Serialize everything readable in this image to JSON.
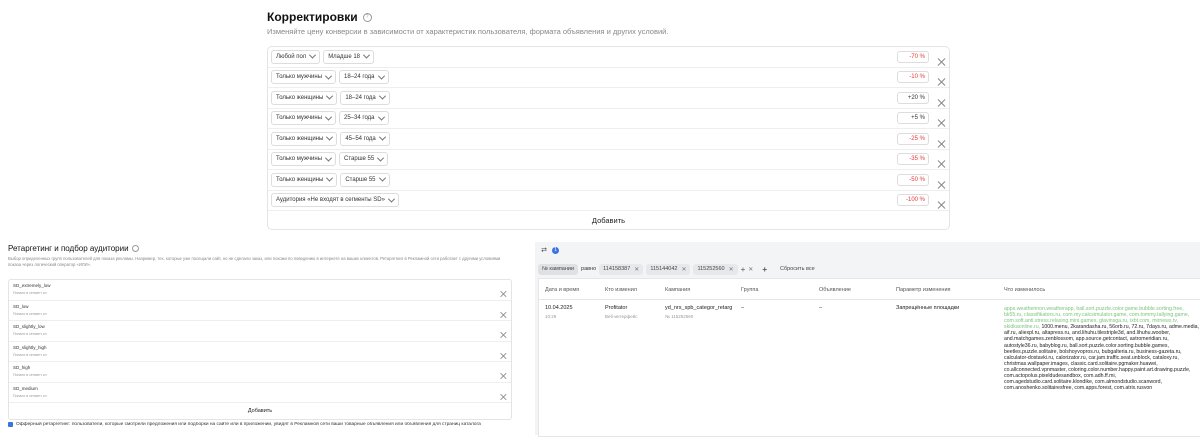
{
  "adjustments": {
    "title": "Корректировки",
    "subtitle": "Изменяйте цену конверсии в зависимости от характеристик пользователя, формата объявления и других условий.",
    "rows": [
      {
        "a": "Любой пол",
        "b": "Младше 18",
        "value": "-70 %",
        "negative": true
      },
      {
        "a": "Только мужчины",
        "b": "18–24 года",
        "value": "-10 %",
        "negative": true
      },
      {
        "a": "Только женщины",
        "b": "18–24 года",
        "value": "+20 %",
        "negative": false
      },
      {
        "a": "Только мужчины",
        "b": "25–34 года",
        "value": "+5 %",
        "negative": false
      },
      {
        "a": "Только женщины",
        "b": "45–54 года",
        "value": "-25 %",
        "negative": true
      },
      {
        "a": "Только мужчины",
        "b": "Старше 55",
        "value": "-35 %",
        "negative": true
      },
      {
        "a": "Только женщины",
        "b": "Старше 55",
        "value": "-50 %",
        "negative": true
      },
      {
        "a": "Аудитория «Не входят в сегменты SD»",
        "b": "",
        "value": "-100 %",
        "negative": true
      }
    ],
    "add_label": "Добавить"
  },
  "retargeting": {
    "title": "Ретаргетинг и подбор аудитории",
    "description": "Выбор определенных групп пользователей для показа рекламы. Например, тех, которые уже посещали сайт, но не сделали заказ, или похожи по поведению в интернете на ваших клиентов. Ретаргетинг в Рекламной сети работает с другими условиями показа через логический оператор «ИЛИ».",
    "items": [
      {
        "name": "SD_extremely_low",
        "status": "Попали в сегмент кл"
      },
      {
        "name": "SD_low",
        "status": "Попали в сегмент кл"
      },
      {
        "name": "SD_slightly_low",
        "status": "Попали в сегмент кл"
      },
      {
        "name": "SD_slightly_high",
        "status": "Попали в сегмент кл"
      },
      {
        "name": "SD_high",
        "status": "Попали в сегмент кл"
      },
      {
        "name": "SD_medium",
        "status": "Попали в сегмент кл"
      }
    ],
    "add_label": "Добавить",
    "offer_text": "Офферный ретаргетинг: пользователи, которые смотрели предложения или подборки на сайте или в приложении, увидят в Рекламной сети ваши товарные объявления или объявления для страниц каталога"
  },
  "history": {
    "filter_count": "1",
    "filter_field": "№ кампании",
    "filter_op": "равно",
    "filter_values": [
      "114158387",
      "115144042",
      "115252560"
    ],
    "reset_label": "Сбросить все",
    "columns": [
      "Дата и время",
      "Кто изменил",
      "Кампания",
      "Группа",
      "Объявление",
      "Параметр изменения",
      "Что изменилось"
    ],
    "row": {
      "date": "10.04.2025",
      "time": "10:29",
      "who": "Profitator",
      "who_sub": "Веб-интерфейс",
      "campaign": "yd_nrs_spb_categor_retarg",
      "campaign_id": "№ 115252560",
      "group": "–",
      "ad": "–",
      "param": "Запрещённые площадки",
      "changed_green": "apps.weatherinon.weatherapp, ball.sort.puzzle.color.game.bubble.sorting.free, bk55.ru, classifikators.ru, com.my.calcsimulator.game, com.tommy.tallying.game, com.soft.anti.stress.relaxing.mini.games, glavinsga.ru, ixbt.com, mirnews.tv, skidkaonline.ru,",
      "changed_black": "1000.menu, 2karandasha.ru, 56orb.ru, 72.ru, 7days.ru, adme.media, aif.ru, aliexpl.ru, altapress.ru, and.lihuhu.tilestriple3d, and.lihuhu.woober, and.matchgames.zenblossom, app.source.getcontact, astromeridian.ru, autostyle36.ru, babyblog.ru, ball.sort.puzzle.color.sorting.bubble.games, beetles.puzzle.solitaire, bolshoyvopros.ru, bubgalteria.ru, business-gazeta.ru, calculator-dostavki.ru, calorizator.ru, car.jam.traffic.seat.unblock, cataloxy.ru, christmas.wallpaper.images, classic.card.solitaire.pgmaker.huawei, co.allconnected.vpnmaster, coloring.color.number.happy.paint.art.drawing.puzzle, com.actopolus.pixeldudesandbox, com.adh.ff.mi, com.agedstudio.card.solitaire.klondike, com.almondstudio.scanword, com.anoshenko.solitairesfree, com.apps.forest, com.atrix.rusvon"
    }
  }
}
